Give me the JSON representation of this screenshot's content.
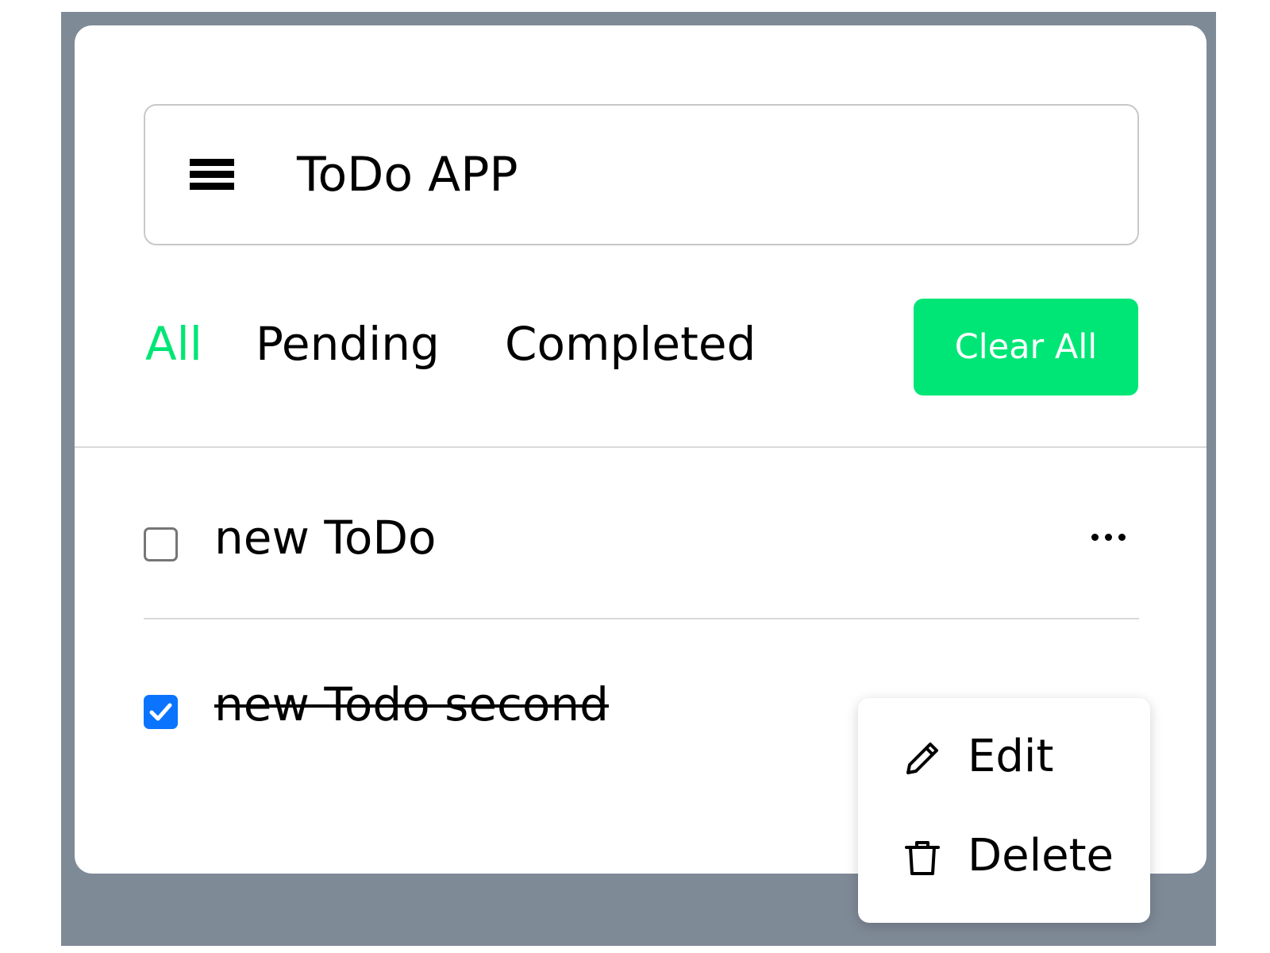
{
  "header": {
    "title": "ToDo APP",
    "menu_icon": "hamburger-menu-icon"
  },
  "filters": {
    "tabs": [
      {
        "label": "All",
        "active": true
      },
      {
        "label": "Pending",
        "active": false
      },
      {
        "label": "Completed",
        "active": false
      }
    ],
    "clear_label": "Clear All"
  },
  "tasks": [
    {
      "text": "new ToDo",
      "completed": false
    },
    {
      "text": "new Todo second",
      "completed": true
    }
  ],
  "context_menu": {
    "items": [
      {
        "label": "Edit",
        "icon": "pencil-icon"
      },
      {
        "label": "Delete",
        "icon": "trash-icon"
      }
    ]
  },
  "colors": {
    "accent": "#00e676",
    "checkbox_checked": "#0a74ff",
    "backdrop": "#7f8a97"
  }
}
